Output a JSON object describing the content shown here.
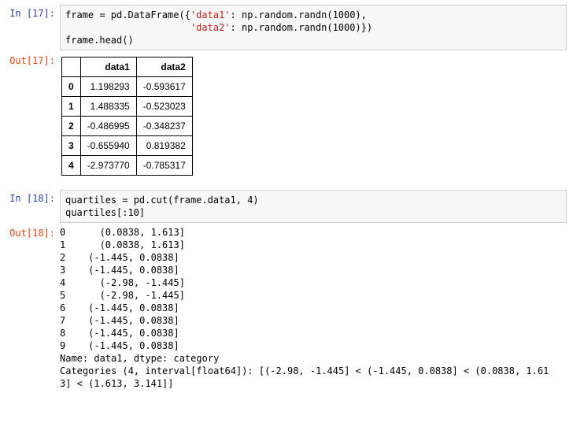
{
  "cells": {
    "c17": {
      "in_prompt": "In  [17]:",
      "out_prompt": "Out[17]:",
      "code_line1_a": "frame = pd.DataFrame({",
      "code_line1_str1": "'data1'",
      "code_line1_b": ": np.random.randn(1000),",
      "code_line2_pad": "                      ",
      "code_line2_str2": "'data2'",
      "code_line2_b": ": np.random.randn(1000)})",
      "code_line3": "frame.head()",
      "table": {
        "columns": [
          "data1",
          "data2"
        ],
        "rows": [
          {
            "idx": "0",
            "data1": "1.198293",
            "data2": "-0.593617"
          },
          {
            "idx": "1",
            "data1": "1.488335",
            "data2": "-0.523023"
          },
          {
            "idx": "2",
            "data1": "-0.486995",
            "data2": "-0.348237"
          },
          {
            "idx": "3",
            "data1": "-0.655940",
            "data2": "0.819382"
          },
          {
            "idx": "4",
            "data1": "-2.973770",
            "data2": "-0.785317"
          }
        ]
      }
    },
    "c18": {
      "in_prompt": "In  [18]:",
      "out_prompt": "Out[18]:",
      "code_line1": "quartiles = pd.cut(frame.data1, 4)",
      "code_line2": "quartiles[:10]",
      "output": "0      (0.0838, 1.613]\n1      (0.0838, 1.613]\n2    (-1.445, 0.0838]\n3    (-1.445, 0.0838]\n4      (-2.98, -1.445]\n5      (-2.98, -1.445]\n6    (-1.445, 0.0838]\n7    (-1.445, 0.0838]\n8    (-1.445, 0.0838]\n9    (-1.445, 0.0838]\nName: data1, dtype: category\nCategories (4, interval[float64]): [(-2.98, -1.445] < (-1.445, 0.0838] < (0.0838, 1.61\n3] < (1.613, 3.141]]"
    }
  }
}
